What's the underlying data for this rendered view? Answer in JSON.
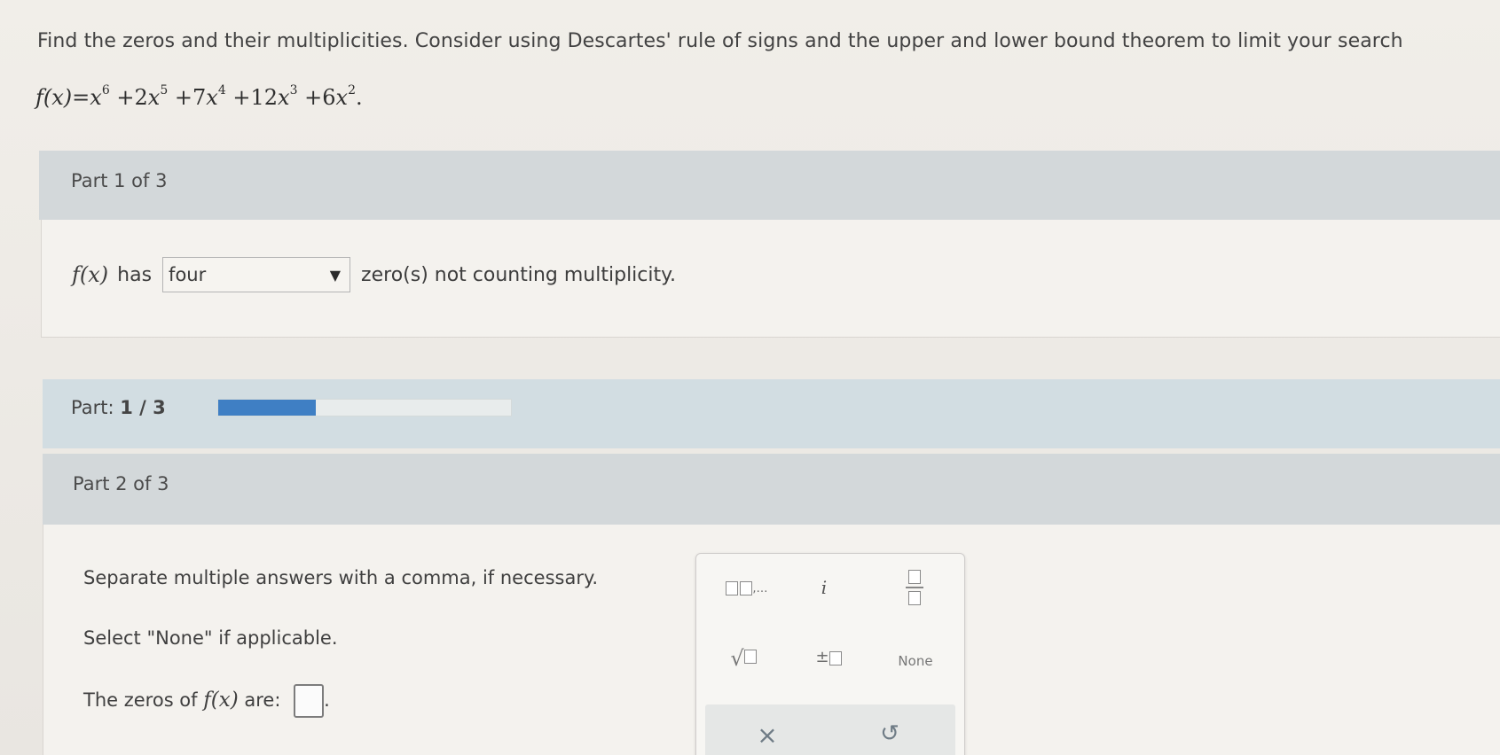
{
  "problem": {
    "instruction": "Find the zeros and their multiplicities. Consider using Descartes' rule of signs and the upper and lower bound theorem to limit your search",
    "function_lhs": "f(x)=",
    "terms": [
      {
        "coef": "",
        "var": "x",
        "exp": "6",
        "sign": ""
      },
      {
        "coef": "2",
        "var": "x",
        "exp": "5",
        "sign": "+"
      },
      {
        "coef": "7",
        "var": "x",
        "exp": "4",
        "sign": "+"
      },
      {
        "coef": "12",
        "var": "x",
        "exp": "3",
        "sign": "+"
      },
      {
        "coef": "6",
        "var": "x",
        "exp": "2",
        "sign": "+"
      }
    ],
    "end": "."
  },
  "part1": {
    "header": "Part 1 of 3",
    "fx": "f(x)",
    "has": "has",
    "select_value": "four",
    "suffix": "zero(s) not counting multiplicity."
  },
  "progress": {
    "label": "Part:",
    "current": "1 / 3",
    "fraction": 0.333
  },
  "part2": {
    "header": "Part 2 of 3",
    "line1": "Separate multiple answers with a comma, if necessary.",
    "line2": "Select \"None\" if applicable.",
    "zeros_prefix": "The zeros of",
    "fx": "f(x)",
    "zeros_suffix": "are:",
    "period": "."
  },
  "keypad": {
    "list_label": ",…",
    "imag": "i",
    "none": "None",
    "clear_symbol": "×",
    "undo_symbol": "↺",
    "pm": "±"
  }
}
